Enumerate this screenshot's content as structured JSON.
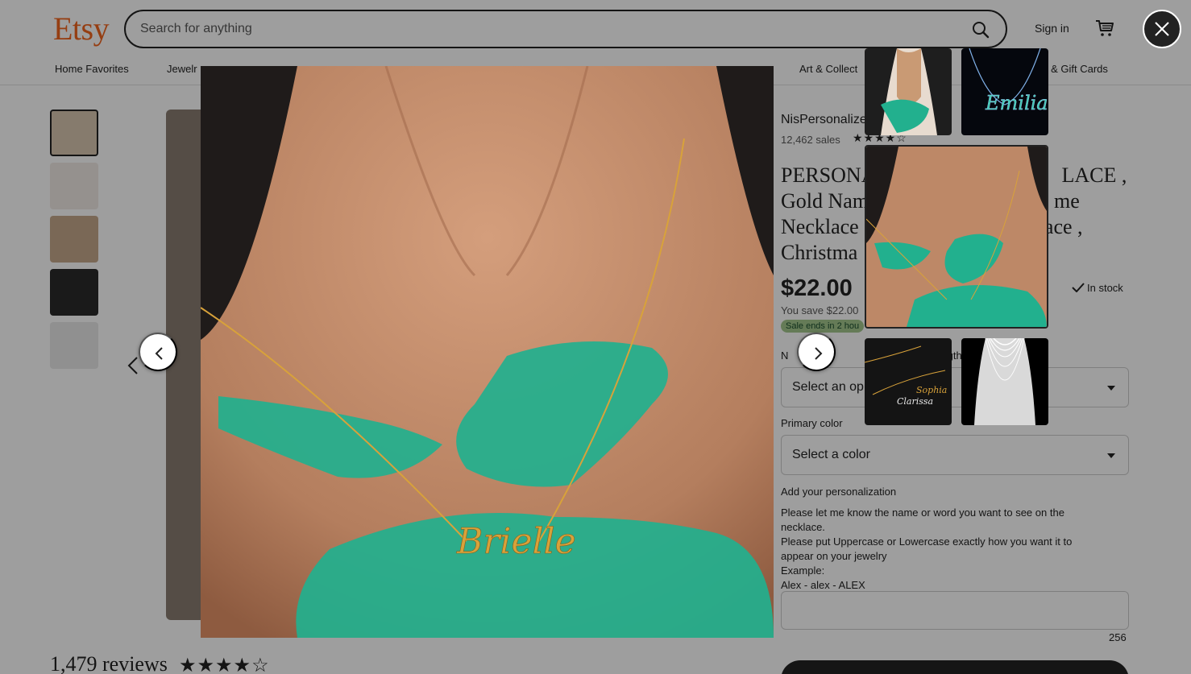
{
  "header": {
    "logo": "Etsy",
    "search_placeholder": "Search for anything",
    "sign_in": "Sign in"
  },
  "categories": [
    "Home Favorites",
    "Jewelr",
    "Art & Collect",
    "s & Gift Cards"
  ],
  "listing": {
    "shop_name": "NisPersonalize",
    "sales": "12,462 sales",
    "title_lines": [
      "PERSONA",
      "LACE ,",
      "Gold Nam",
      "me",
      "Necklace",
      "klace ,",
      "Christma"
    ],
    "price": "$22.00",
    "in_stock": "In stock",
    "you_save": "You save $22.00",
    "sale_ends": "Sale ends in 2 hou",
    "option1_label": "N",
    "option1_label_tail": "ngth",
    "option1_value": "Select an op",
    "primary_color_label": "Primary color",
    "primary_color_value": "Select a color",
    "personalization_label": "Add your personalization",
    "personalization_lines": [
      "Please let me know the name or word you want to see on the",
      "necklace.",
      "Please put Uppercase or Lowercase exactly how you want it to",
      "appear on your jewelry",
      "Example:",
      "Alex - alex - ALEX"
    ],
    "char_counter": "256",
    "reviews_heading": "1,479 reviews"
  },
  "overlay": {
    "photo_name_text": "Brielle",
    "thumb_names": [
      "Emilia",
      "Clarissa",
      "Sophia"
    ]
  }
}
